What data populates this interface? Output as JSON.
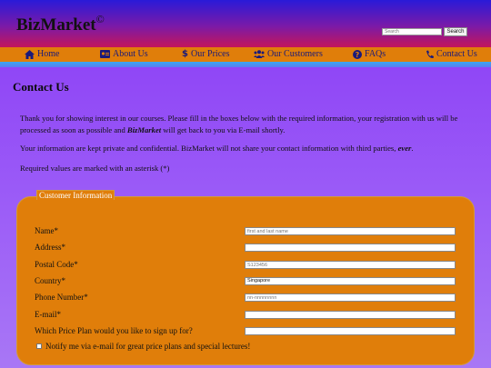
{
  "brand": {
    "name": "BizMarket",
    "mark": "©"
  },
  "search": {
    "placeholder": "Search",
    "button": "Search"
  },
  "nav": {
    "items": [
      {
        "label": "Home",
        "icon": "home-icon"
      },
      {
        "label": "About Us",
        "icon": "id-card-icon"
      },
      {
        "label": "Our Prices",
        "icon": "dollar-icon"
      },
      {
        "label": "Our Customers",
        "icon": "users-icon"
      },
      {
        "label": "FAQs",
        "icon": "question-icon"
      },
      {
        "label": "Contact Us",
        "icon": "phone-icon"
      }
    ]
  },
  "page": {
    "title": "Contact Us",
    "intro_a": "Thank you for showing interest in our courses. Please fill in the boxes below with the required information, your registration with us will be processed as soon as possible and ",
    "intro_brand": "BizMarket",
    "intro_b": " will get back to you via E-mail shortly.",
    "privacy_a": "Your information are kept private and confidential. BizMarket will not share your contact information with third parties, ",
    "privacy_em": "ever",
    "privacy_b": ".",
    "required": "Required values are marked with an asterisk (*)"
  },
  "form": {
    "legend": "Customer Information",
    "fields": [
      {
        "label": "Name*",
        "placeholder": "first and last name",
        "value": ""
      },
      {
        "label": "Address*",
        "placeholder": "",
        "value": ""
      },
      {
        "label": "Postal Code*",
        "placeholder": "S123456",
        "value": ""
      },
      {
        "label": "Country*",
        "placeholder": "",
        "value": "Singapore"
      },
      {
        "label": "Phone Number*",
        "placeholder": "nn-nnnnnnnn",
        "value": ""
      },
      {
        "label": "E-mail*",
        "placeholder": "",
        "value": ""
      },
      {
        "label": "Which Price Plan would you like to sign up for?",
        "placeholder": "",
        "value": ""
      }
    ],
    "notify_label": "Notify me via e-mail for great price plans and special lectures!"
  },
  "colors": {
    "nav_bg": "#e07e0a",
    "nav_text": "#1a1a7a",
    "form_bg": "#e07e0a",
    "page_bg": "#9d5ff7"
  }
}
